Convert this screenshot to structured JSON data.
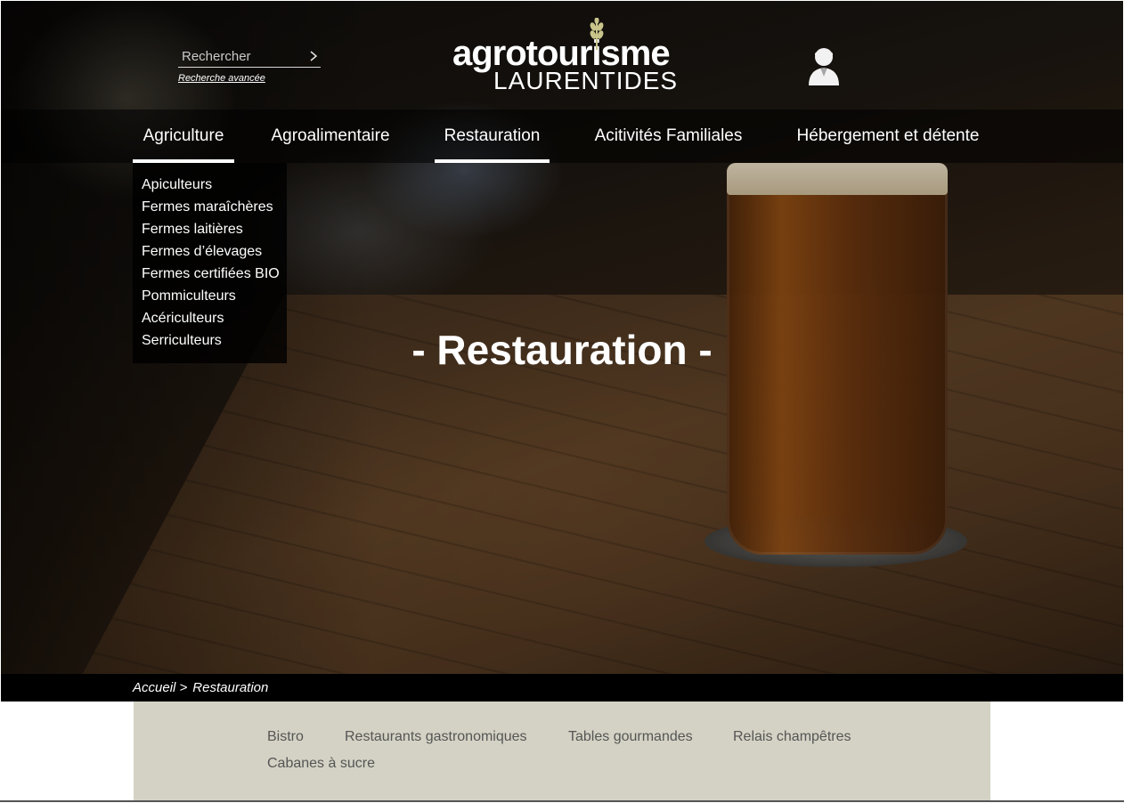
{
  "header": {
    "search": {
      "placeholder": "Rechercher",
      "arrow_icon": "chevron-right-icon",
      "advanced_label": "Recherche avancée"
    },
    "logo": {
      "top": "agrotourisme",
      "bottom": "LAURENTIDES",
      "icon": "wheat-icon",
      "accent_color": "#c8c48a"
    },
    "user_icon": "user-icon"
  },
  "nav": {
    "items": [
      {
        "label": "Agriculture",
        "active": true
      },
      {
        "label": "Agroalimentaire",
        "active": false
      },
      {
        "label": "Restauration",
        "active": true
      },
      {
        "label": "Acitivités Familiales",
        "active": false
      },
      {
        "label": "Hébergement et détente",
        "active": false
      }
    ]
  },
  "dropdown": {
    "items": [
      "Apiculteurs",
      "Fermes maraîchères",
      "Fermes laitières",
      "Fermes d’élevages",
      "Fermes certifiées BIO",
      "Pommiculteurs",
      "Acériculteurs",
      "Serriculteurs"
    ]
  },
  "hero": {
    "title": "- Restauration -"
  },
  "breadcrumb": {
    "home": "Accueil >",
    "current": "Restauration"
  },
  "subcategories": {
    "items": [
      "Bistro",
      "Restaurants gastronomiques",
      "Tables gourmandes",
      "Relais champêtres",
      "Cabanes à sucre"
    ],
    "panel_color": "#d4d2c4"
  }
}
